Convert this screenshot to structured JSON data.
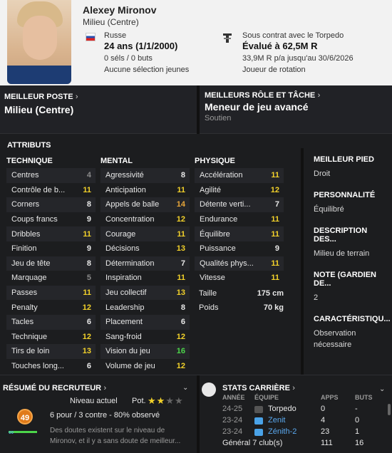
{
  "player": {
    "name": "Alexey Mironov",
    "position": "Milieu (Centre)",
    "nationality": "Russe",
    "age": "24 ans (1/1/2000)",
    "caps": "0 séls / 0 buts",
    "youth": "Aucune sélection jeunes",
    "contract": "Sous contrat avec le Torpedo",
    "value": "Évalué à 62,5M R",
    "wage": "33,9M R p/a jusqu'au 30/6/2026",
    "role_status": "Joueur de rotation"
  },
  "best_position": {
    "label": "MEILLEUR POSTE",
    "value": "Milieu (Centre)"
  },
  "best_role": {
    "label": "MEILLEURS RÔLE ET TÂCHE",
    "value": "Meneur de jeu avancé",
    "duty": "Soutien"
  },
  "attributes": {
    "title": "ATTRIBUTS",
    "technical": {
      "title": "TECHNIQUE",
      "items": [
        [
          "Centres",
          "4",
          "gray"
        ],
        [
          "Contrôle de b...",
          "11",
          "yellow"
        ],
        [
          "Corners",
          "8",
          "white"
        ],
        [
          "Coups francs",
          "9",
          "white"
        ],
        [
          "Dribbles",
          "11",
          "yellow"
        ],
        [
          "Finition",
          "9",
          "white"
        ],
        [
          "Jeu de tête",
          "8",
          "white"
        ],
        [
          "Marquage",
          "5",
          "gray"
        ],
        [
          "Passes",
          "11",
          "yellow"
        ],
        [
          "Penalty",
          "12",
          "yellow"
        ],
        [
          "Tacles",
          "6",
          "white"
        ],
        [
          "Technique",
          "12",
          "yellow"
        ],
        [
          "Tirs de loin",
          "13",
          "yellow"
        ],
        [
          "Touches long...",
          "6",
          "white"
        ]
      ]
    },
    "mental": {
      "title": "MENTAL",
      "items": [
        [
          "Agressivité",
          "8",
          "white"
        ],
        [
          "Anticipation",
          "11",
          "yellow"
        ],
        [
          "Appels de balle",
          "14",
          "orange"
        ],
        [
          "Concentration",
          "12",
          "yellow"
        ],
        [
          "Courage",
          "11",
          "yellow"
        ],
        [
          "Décisions",
          "13",
          "yellow"
        ],
        [
          "Détermination",
          "7",
          "white"
        ],
        [
          "Inspiration",
          "11",
          "yellow"
        ],
        [
          "Jeu collectif",
          "13",
          "yellow"
        ],
        [
          "Leadership",
          "8",
          "white"
        ],
        [
          "Placement",
          "6",
          "white"
        ],
        [
          "Sang-froid",
          "12",
          "yellow"
        ],
        [
          "Vision du jeu",
          "16",
          "green"
        ],
        [
          "Volume de jeu",
          "12",
          "yellow"
        ]
      ]
    },
    "physical": {
      "title": "PHYSIQUE",
      "items": [
        [
          "Accélération",
          "11",
          "yellow"
        ],
        [
          "Agilité",
          "12",
          "yellow"
        ],
        [
          "Détente verti...",
          "7",
          "white"
        ],
        [
          "Endurance",
          "11",
          "yellow"
        ],
        [
          "Équilibre",
          "11",
          "yellow"
        ],
        [
          "Puissance",
          "9",
          "white"
        ],
        [
          "Qualités phys...",
          "11",
          "yellow"
        ],
        [
          "Vitesse",
          "11",
          "yellow"
        ]
      ],
      "height_label": "Taille",
      "height": "175 cm",
      "weight_label": "Poids",
      "weight": "70 kg"
    }
  },
  "side": {
    "foot_label": "MEILLEUR PIED",
    "foot": "Droit",
    "pers_label": "PERSONNALITÉ",
    "pers": "Équilibré",
    "desc_label": "DESCRIPTION DES...",
    "desc": "Milieu de terrain",
    "gk_label": "NOTE (GARDIEN DE...",
    "gk": "2",
    "char_label": "CARACTÉRISTIQU...",
    "char": "Observation nécessaire"
  },
  "scout": {
    "title": "RÉSUMÉ DU RECRUTEUR",
    "current": "Niveau actuel",
    "potential": "Pot.",
    "rating": "49",
    "summary": "6 pour / 3 contre - 80% observé",
    "text": "Des doutes existent sur le niveau de Mironov, et il y a sans doute de meilleur..."
  },
  "career": {
    "title": "STATS CARRIÈRE",
    "cols": [
      "ANNÉE",
      "ÉQUIPE",
      "APPS",
      "BUTS"
    ],
    "rows": [
      [
        "24-25",
        "Torpedo",
        "0",
        "-"
      ],
      [
        "23-24",
        "Zenit",
        "4",
        "0"
      ],
      [
        "23-24",
        "Zénith-2",
        "23",
        "1"
      ]
    ],
    "total_label": "Général 7 club(s)",
    "total_apps": "111",
    "total_goals": "16"
  },
  "colors": {
    "gray": "#8a8a8a",
    "white": "#e8e8e8",
    "yellow": "#f2d12a",
    "green": "#4cd54a",
    "orange": "#e8a63a"
  }
}
